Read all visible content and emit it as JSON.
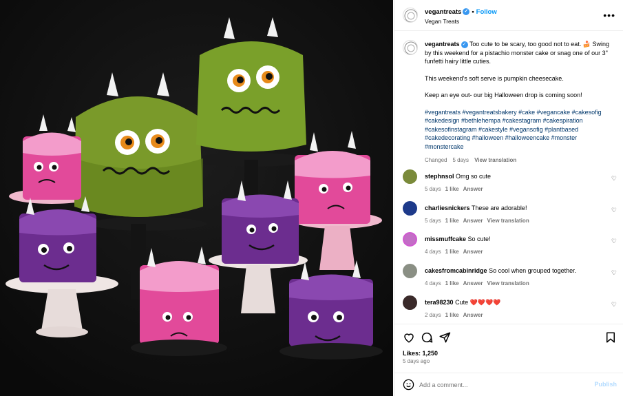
{
  "post": {
    "username": "vegantreats",
    "follow_label": "Follow",
    "location": "Vegan Treats",
    "more_icon": "more-horizontal-icon",
    "caption": {
      "username": "vegantreats",
      "line1": "Too cute to be scary, too good not to eat. 🍰 Swing by this weekend for a pistachio monster cake or snag one of our 3\" funfetti hairy little cuties.",
      "line2": "This weekend's soft serve is pumpkin cheesecake.",
      "line3": "Keep an eye out- our big Halloween drop is coming soon!",
      "hashtags": "#vegantreats #vegantreatsbakery #cake #vegancake #cakesofig #cakedesign #bethlehempa #cakestagram #cakespiration #cakesofinstagram #cakestyle #vegansofig #plantbased #cakedecorating #halloween #halloweencake #monster #monstercake",
      "changed": "Changed",
      "time": "5 days",
      "view_translation": "View translation"
    }
  },
  "comments": [
    {
      "user": "stephnsol",
      "text": "Omg so cute",
      "time": "5 days",
      "likes": "1 like",
      "reply": "Answer",
      "translate": "",
      "avatar_color": "#7a8a3a"
    },
    {
      "user": "charliesnickers",
      "text": "These are adorable!",
      "time": "5 days",
      "likes": "1 like",
      "reply": "Answer",
      "translate": "View translation",
      "avatar_color": "#1d3a8a"
    },
    {
      "user": "missmuffcake",
      "text": "So cute!",
      "time": "4 days",
      "likes": "1 like",
      "reply": "Answer",
      "translate": "",
      "avatar_color": "#c36ec6"
    },
    {
      "user": "cakesfromcabinridge",
      "text": "So cool when grouped together.",
      "time": "4 days",
      "likes": "1 like",
      "reply": "Answer",
      "translate": "View translation",
      "avatar_color": "#8a8f84"
    },
    {
      "user": "tera98230",
      "text": "Cute ❤️❤️❤️❤️",
      "time": "2 days",
      "likes": "1 like",
      "reply": "Answer",
      "translate": "",
      "avatar_color": "#3a2a2a"
    }
  ],
  "footer": {
    "likes": "Likes: 1,250",
    "ago": "5 days ago",
    "add_comment_placeholder": "Add a comment...",
    "publish": "Publish"
  }
}
